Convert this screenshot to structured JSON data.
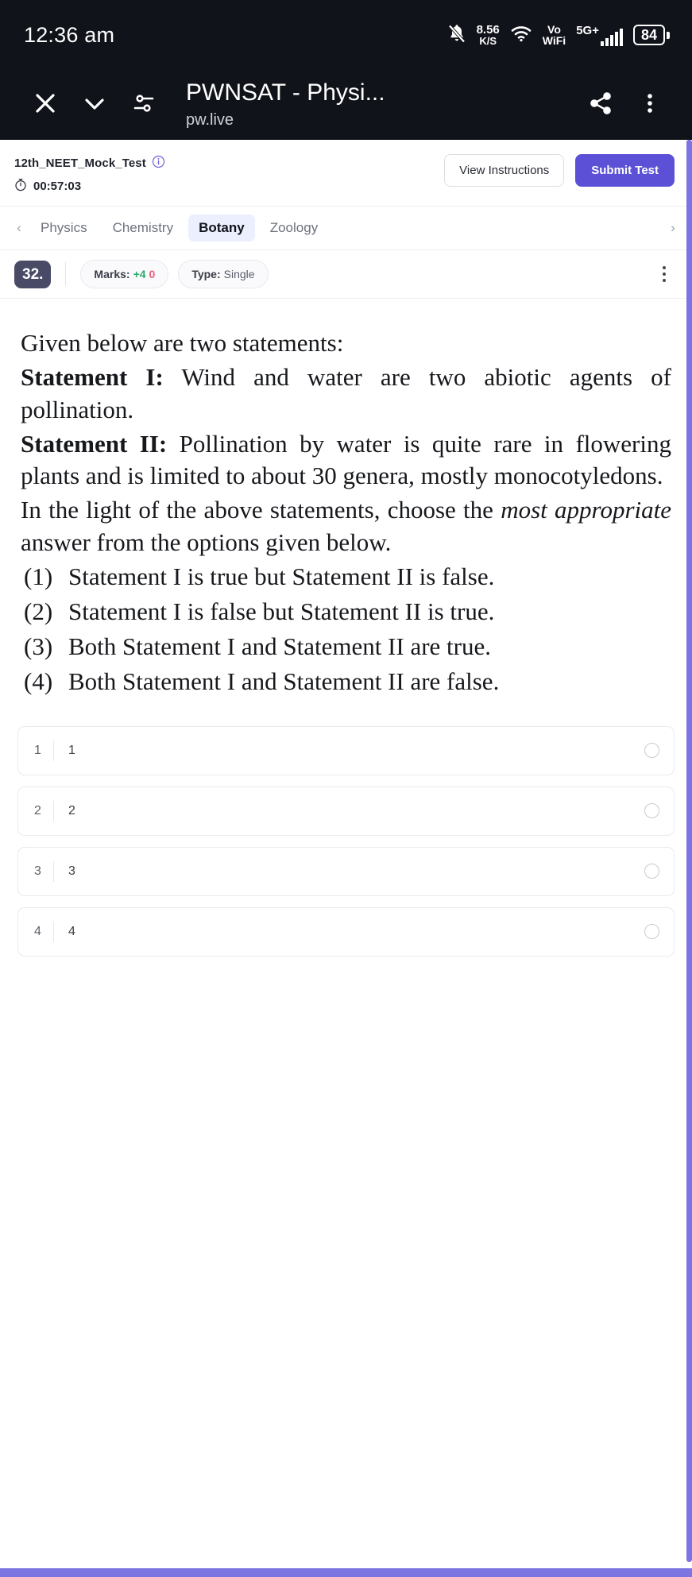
{
  "status_bar": {
    "time": "12:36 am",
    "notification_icon": "bell-muted-icon",
    "net_speed_value": "8.56",
    "net_speed_unit": "K/S",
    "wifi_icon": "wifi-icon",
    "volte_line1": "Vo",
    "volte_line2": "WiFi",
    "network_label": "5G+",
    "signal_icon": "signal-bars-icon",
    "battery_level": "84"
  },
  "browser_bar": {
    "close_icon": "close-icon",
    "collapse_icon": "chevron-down-icon",
    "tune_icon": "tune-sliders-icon",
    "title": "PWNSAT - Physi...",
    "url": "pw.live",
    "share_icon": "share-icon",
    "more_icon": "overflow-menu-icon"
  },
  "test_header": {
    "test_name": "12th_NEET_Mock_Test",
    "info_icon": "info-icon",
    "timer_icon": "stopwatch-icon",
    "timer": "00:57:03",
    "view_instructions_label": "View Instructions",
    "submit_test_label": "Submit Test",
    "primary_color": "#5b50d6"
  },
  "subject_tabs": {
    "prev_icon": "chevron-left-icon",
    "next_icon": "chevron-right-icon",
    "items": [
      {
        "label": "Physics",
        "active": false
      },
      {
        "label": "Chemistry",
        "active": false
      },
      {
        "label": "Botany",
        "active": true
      },
      {
        "label": "Zoology",
        "active": false
      }
    ]
  },
  "question_meta": {
    "number": "32.",
    "marks_label": "Marks:",
    "marks_positive": "+4",
    "marks_negative": "0",
    "type_label": "Type:",
    "type_value": "Single",
    "more_icon": "overflow-menu-icon"
  },
  "question": {
    "intro": "Given below are two statements:",
    "statement_1_label": "Statement I:",
    "statement_1_text": " Wind and water are two abiotic agents of pollination.",
    "statement_2_label": "Statement II:",
    "statement_2_text": " Pollination by water is quite rare in flowering plants and is limited to about 30 genera, mostly monocotyledons.",
    "instruction_pre": "In the light of the above statements, choose the ",
    "instruction_em": "most appropriate",
    "instruction_post": " answer from the options given below.",
    "options": [
      {
        "num": "(1)",
        "text": "Statement I is true but Statement II is false."
      },
      {
        "num": "(2)",
        "text": "Statement I is false but Statement II is true."
      },
      {
        "num": "(3)",
        "text": "Both Statement I and Statement II are true."
      },
      {
        "num": "(4)",
        "text": "Both Statement I and Statement II are false."
      }
    ]
  },
  "answer_rows": [
    {
      "index": "1",
      "text": "1",
      "selected": false
    },
    {
      "index": "2",
      "text": "2",
      "selected": false
    },
    {
      "index": "3",
      "text": "3",
      "selected": false
    },
    {
      "index": "4",
      "text": "4",
      "selected": false
    }
  ]
}
